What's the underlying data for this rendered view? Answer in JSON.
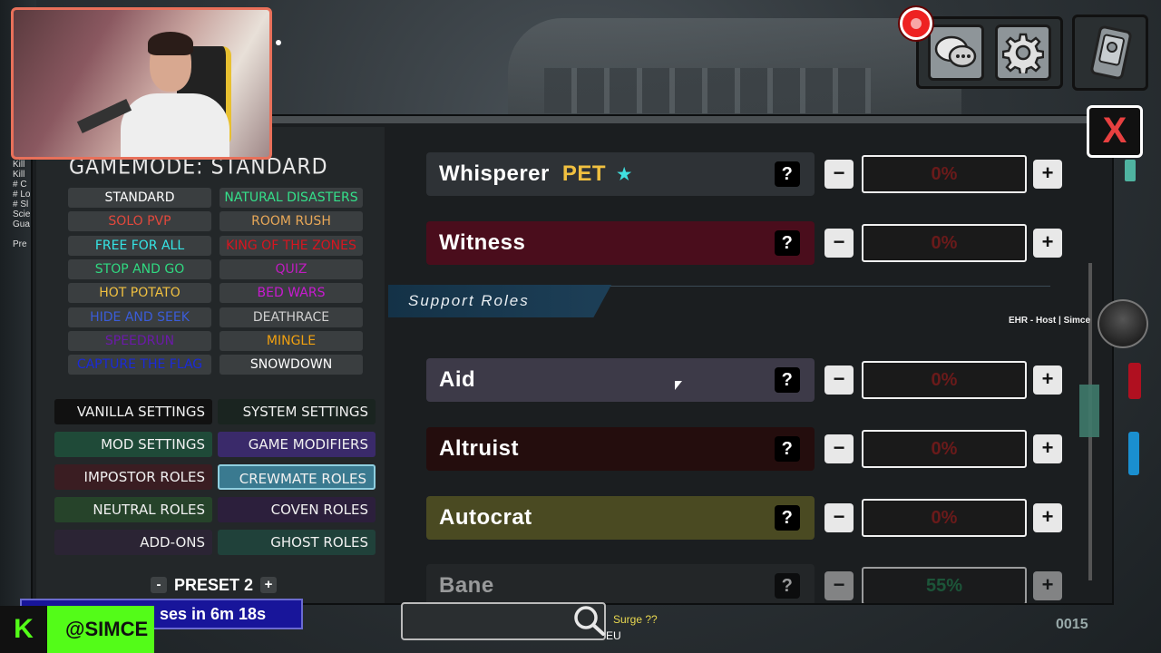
{
  "side_log": [
    "Kill",
    "Kill",
    "# C",
    "# Lo",
    "# Sl",
    "Scie",
    "Gua",
    "",
    "Pre"
  ],
  "gamemode": {
    "title": "GAMEMODE: STANDARD",
    "modes": [
      {
        "label": "STANDARD",
        "color": "#ffffff"
      },
      {
        "label": "NATURAL DISASTERS",
        "color": "#34e08a"
      },
      {
        "label": "SOLO PVP",
        "color": "#e2483c"
      },
      {
        "label": "ROOM RUSH",
        "color": "#e8a858"
      },
      {
        "label": "FREE FOR ALL",
        "color": "#35e6e6"
      },
      {
        "label": "KING OF THE ZONES",
        "color": "#d8151f"
      },
      {
        "label": "STOP AND GO",
        "color": "#30d880"
      },
      {
        "label": "QUIZ",
        "color": "#c01cc0"
      },
      {
        "label": "HOT POTATO",
        "color": "#f0c040"
      },
      {
        "label": "BED WARS",
        "color": "#c81ad0"
      },
      {
        "label": "HIDE AND SEEK",
        "color": "#3a5cd8"
      },
      {
        "label": "DEATHRACE",
        "color": "#cfcfcf"
      },
      {
        "label": "SPEEDRUN",
        "color": "#6b1aa8"
      },
      {
        "label": "MINGLE",
        "color": "#f0a010"
      },
      {
        "label": "CAPTURE THE FLAG",
        "color": "#1a2ad8"
      },
      {
        "label": "SNOWDOWN",
        "color": "#ffffff"
      }
    ]
  },
  "categories": [
    {
      "label": "VANILLA SETTINGS",
      "bg": "#111111"
    },
    {
      "label": "SYSTEM SETTINGS",
      "bg": "#1a2420"
    },
    {
      "label": "MOD SETTINGS",
      "bg": "#1f4a38"
    },
    {
      "label": "GAME MODIFIERS",
      "bg": "#3a2a6a"
    },
    {
      "label": "IMPOSTOR ROLES",
      "bg": "#3a1d22"
    },
    {
      "label": "CREWMATE ROLES",
      "bg": "#3a7a90"
    },
    {
      "label": "NEUTRAL ROLES",
      "bg": "#26432a"
    },
    {
      "label": "COVEN ROLES",
      "bg": "#2c1f3c"
    },
    {
      "label": "ADD-ONS",
      "bg": "#2b2434"
    },
    {
      "label": "GHOST ROLES",
      "bg": "#20413a"
    }
  ],
  "preset": {
    "label": "PRESET 2",
    "minus": "-",
    "plus": "+"
  },
  "section": {
    "title": "Support Roles"
  },
  "roles": [
    {
      "name": "Whisperer",
      "tag": "PET",
      "star": "★",
      "value": "0%",
      "bg": "#2e3236"
    },
    {
      "name": "Witness",
      "tag": "",
      "star": "",
      "value": "0%",
      "bg": "#4a0d1c"
    },
    {
      "name": "Aid",
      "tag": "",
      "star": "",
      "value": "0%",
      "bg": "#3d3a48"
    },
    {
      "name": "Altruist",
      "tag": "",
      "star": "",
      "value": "0%",
      "bg": "#240d0d"
    },
    {
      "name": "Autocrat",
      "tag": "",
      "star": "",
      "value": "0%",
      "bg": "#4a4a22"
    },
    {
      "name": "Bane",
      "tag": "",
      "star": "",
      "value": "55%",
      "bg": "#2a2e30"
    }
  ],
  "help_glyph": "?",
  "minus_glyph": "−",
  "plus_glyph": "+",
  "host_label": "EHR - Host | Simce",
  "close_glyph": "X",
  "timer_text": "ses in 6m 18s",
  "streamer": {
    "logo": "K",
    "handle": "@SIMCE"
  },
  "bottom_texts": [
    "Surge ??",
    "EU"
  ],
  "lobby_code": "0015",
  "icons": {
    "chat": "chat-bubbles-icon",
    "settings": "gear-icon",
    "map": "map-icon",
    "search": "search-icon",
    "record": "record-icon"
  },
  "colors": {
    "value_zero": "#6a1a1a",
    "value_set": "#1e7a4a",
    "pet_tag": "#f0c040",
    "star": "#40e0e0"
  }
}
